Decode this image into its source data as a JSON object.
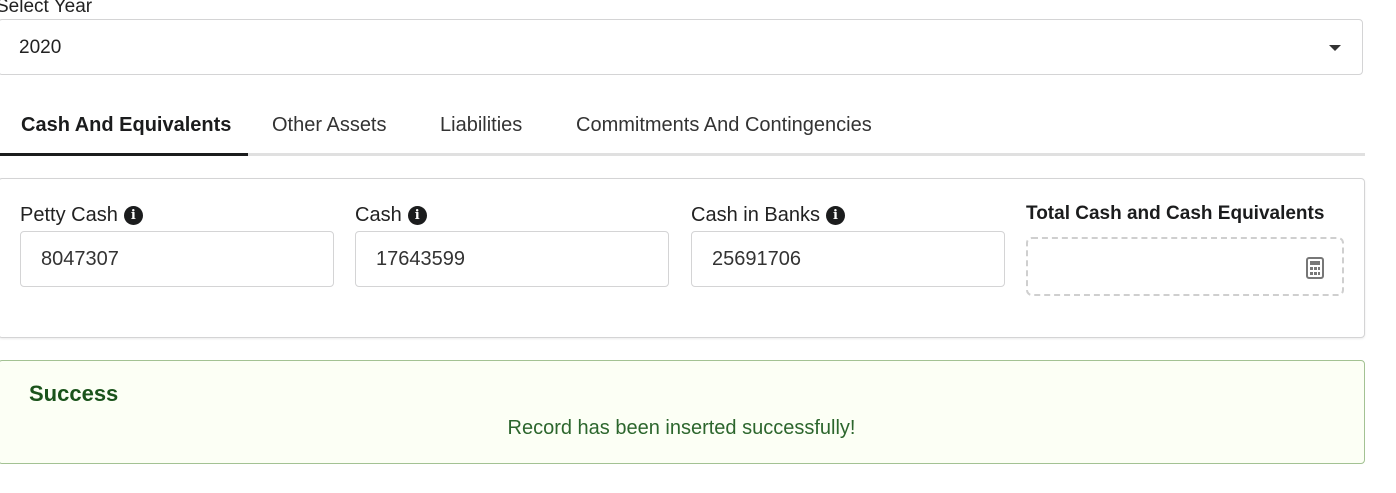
{
  "year_select": {
    "label": "Select Year",
    "value": "2020",
    "caret_icon": "caret-down-icon"
  },
  "tabs": [
    {
      "label": "Cash And Equivalents",
      "active": true
    },
    {
      "label": "Other Assets",
      "active": false
    },
    {
      "label": "Liabilities",
      "active": false
    },
    {
      "label": "Commitments And Contingencies",
      "active": false
    }
  ],
  "fields": {
    "petty_cash": {
      "label": "Petty Cash",
      "value": "8047307",
      "icon": "info-icon"
    },
    "cash": {
      "label": "Cash",
      "value": "17643599",
      "icon": "info-icon"
    },
    "cash_in_banks": {
      "label": "Cash in Banks",
      "value": "25691706",
      "icon": "info-icon"
    },
    "total": {
      "label": "Total Cash and Cash Equivalents",
      "value": "",
      "icon": "calculator-icon"
    }
  },
  "message": {
    "title": "Success",
    "text": "Record has been inserted successfully!",
    "colors": {
      "background": "#fcfff5",
      "border": "#a3c293",
      "title": "#1a531b",
      "text": "#2c662d"
    }
  }
}
